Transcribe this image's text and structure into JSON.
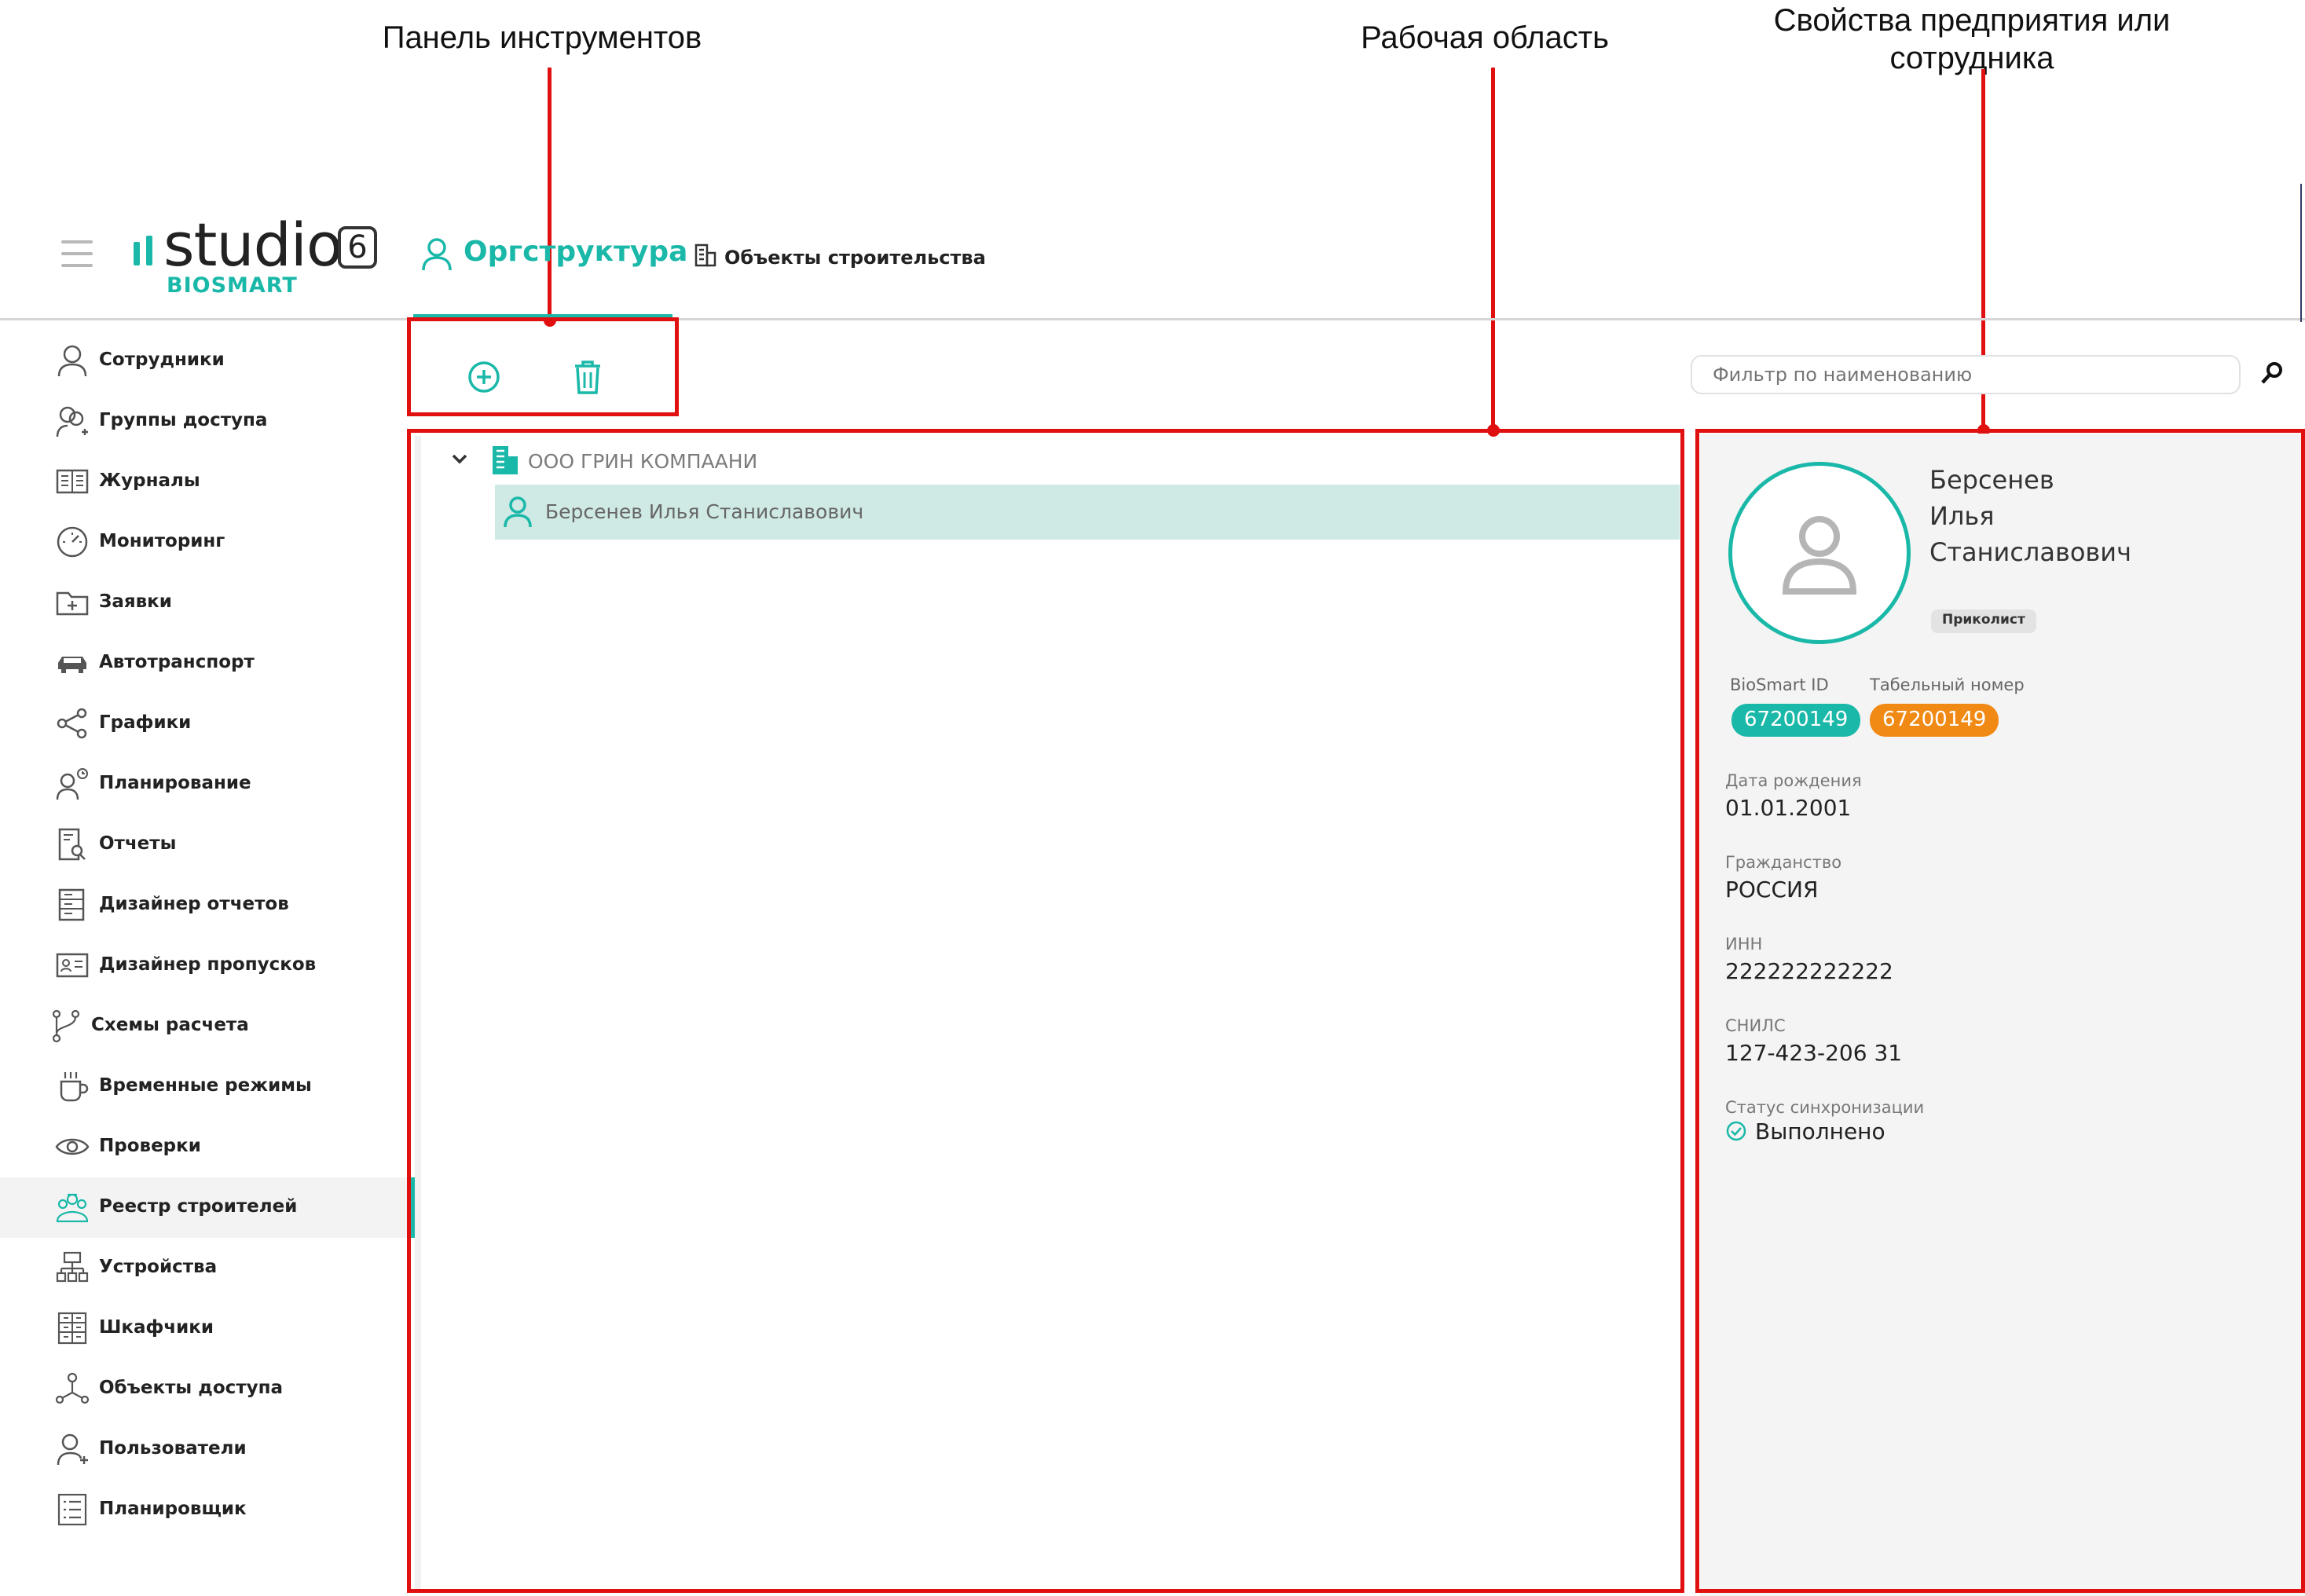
{
  "annotations": {
    "toolbar": "Панель инструментов",
    "workarea": "Рабочая область",
    "properties_line1": "Свойства предприятия или",
    "properties_line2": "сотрудника"
  },
  "logo": {
    "word": "studio",
    "version": "6",
    "sub": "BIOSMART"
  },
  "tabs": [
    {
      "label": "Оргструктура",
      "icon": "person-icon",
      "active": true
    },
    {
      "label": "Объекты строительства",
      "icon": "building-icon",
      "active": false
    }
  ],
  "sidebar": {
    "items": [
      {
        "label": "Сотрудники",
        "icon": "person-icon"
      },
      {
        "label": "Группы доступа",
        "icon": "group-icon"
      },
      {
        "label": "Журналы",
        "icon": "book-icon"
      },
      {
        "label": "Мониторинг",
        "icon": "gauge-icon"
      },
      {
        "label": "Заявки",
        "icon": "folder-plus-icon"
      },
      {
        "label": "Автотранспорт",
        "icon": "car-icon"
      },
      {
        "label": "Графики",
        "icon": "share-icon"
      },
      {
        "label": "Планирование",
        "icon": "person-clock-icon"
      },
      {
        "label": "Отчеты",
        "icon": "report-search-icon"
      },
      {
        "label": "Дизайнер отчетов",
        "icon": "report-designer-icon"
      },
      {
        "label": "Дизайнер пропусков",
        "icon": "id-card-icon"
      },
      {
        "label": "Схемы расчета",
        "icon": "branch-icon"
      },
      {
        "label": "Временные режимы",
        "icon": "cup-icon"
      },
      {
        "label": "Проверки",
        "icon": "eye-icon"
      },
      {
        "label": "Реестр строителей",
        "icon": "builders-icon",
        "active": true
      },
      {
        "label": "Устройства",
        "icon": "devices-icon"
      },
      {
        "label": "Шкафчики",
        "icon": "lockers-icon"
      },
      {
        "label": "Объекты доступа",
        "icon": "nodes-icon"
      },
      {
        "label": "Пользователи",
        "icon": "user-add-icon"
      },
      {
        "label": "Планировщик",
        "icon": "list-icon"
      }
    ]
  },
  "toolbar": {
    "add_icon": "add-circle-icon",
    "delete_icon": "trash-icon"
  },
  "filter": {
    "placeholder": "Фильтр по наименованию"
  },
  "tree": {
    "root": "ООО ГРИН КОМПААНИ",
    "child": "Берсенев Илья Станиславович"
  },
  "person": {
    "name_line1": "Берсенев",
    "name_line2": "Илья",
    "name_line3": "Станиславович",
    "role": "Приколист",
    "biosmart_id_label": "BioSmart ID",
    "tab_number_label": "Табельный номер",
    "biosmart_id": "67200149",
    "tab_number": "67200149",
    "birth_label": "Дата рождения",
    "birth": "01.01.2001",
    "citizenship_label": "Гражданство",
    "citizenship": "РОССИЯ",
    "inn_label": "ИНН",
    "inn": "222222222222",
    "snils_label": "СНИЛС",
    "snils": "127-423-206 31",
    "sync_label": "Статус синхронизации",
    "sync": "Выполнено"
  },
  "colors": {
    "accent": "#1ab8a8",
    "orange": "#f08a14",
    "annotation": "#e01010",
    "selected_row": "#cfe9e4"
  }
}
